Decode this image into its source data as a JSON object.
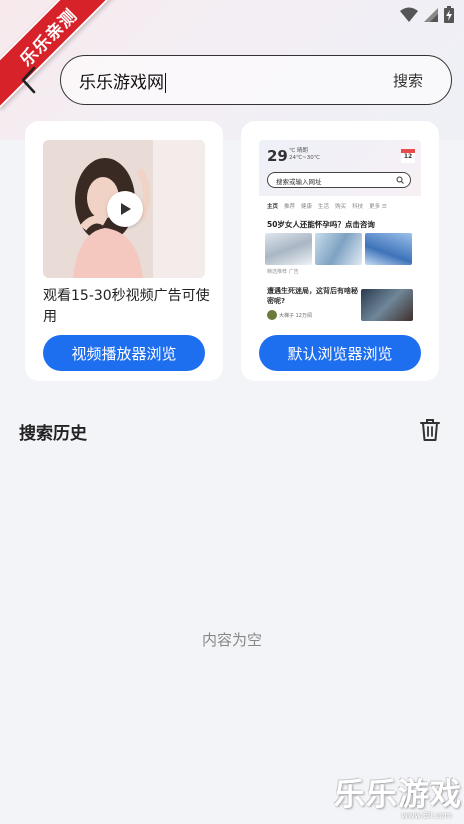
{
  "watermark": {
    "ribbon_text": "乐乐亲测",
    "bottom_logo": "乐乐游戏",
    "bottom_url": "www.6ll.com"
  },
  "search": {
    "value": "乐乐游戏网",
    "button_label": "搜索"
  },
  "cards": {
    "video": {
      "description": "观看15-30秒视频广告可使用",
      "button_label": "视频播放器浏览"
    },
    "browser": {
      "button_label": "默认浏览器浏览",
      "preview": {
        "date": "29",
        "weather_line1": "℃ 晴朗",
        "weather_line2": "24℃~30℃",
        "calendar_day": "12",
        "search_placeholder": "搜索或输入网址",
        "tabs": [
          "主页",
          "推荐",
          "健康",
          "生活",
          "购买",
          "科技",
          "更多 ☰"
        ],
        "news_title": "50岁女人还能怀孕吗？点击咨询",
        "tag": "精选推荐 广告",
        "news2": "遭遇生死迷局，这背后有啥秘密呢?",
        "author": "大梯子 12万阅"
      }
    }
  },
  "history": {
    "title": "搜索历史",
    "empty_text": "内容为空"
  },
  "colors": {
    "accent": "#1e6ef0",
    "ribbon": "#d8222a"
  }
}
